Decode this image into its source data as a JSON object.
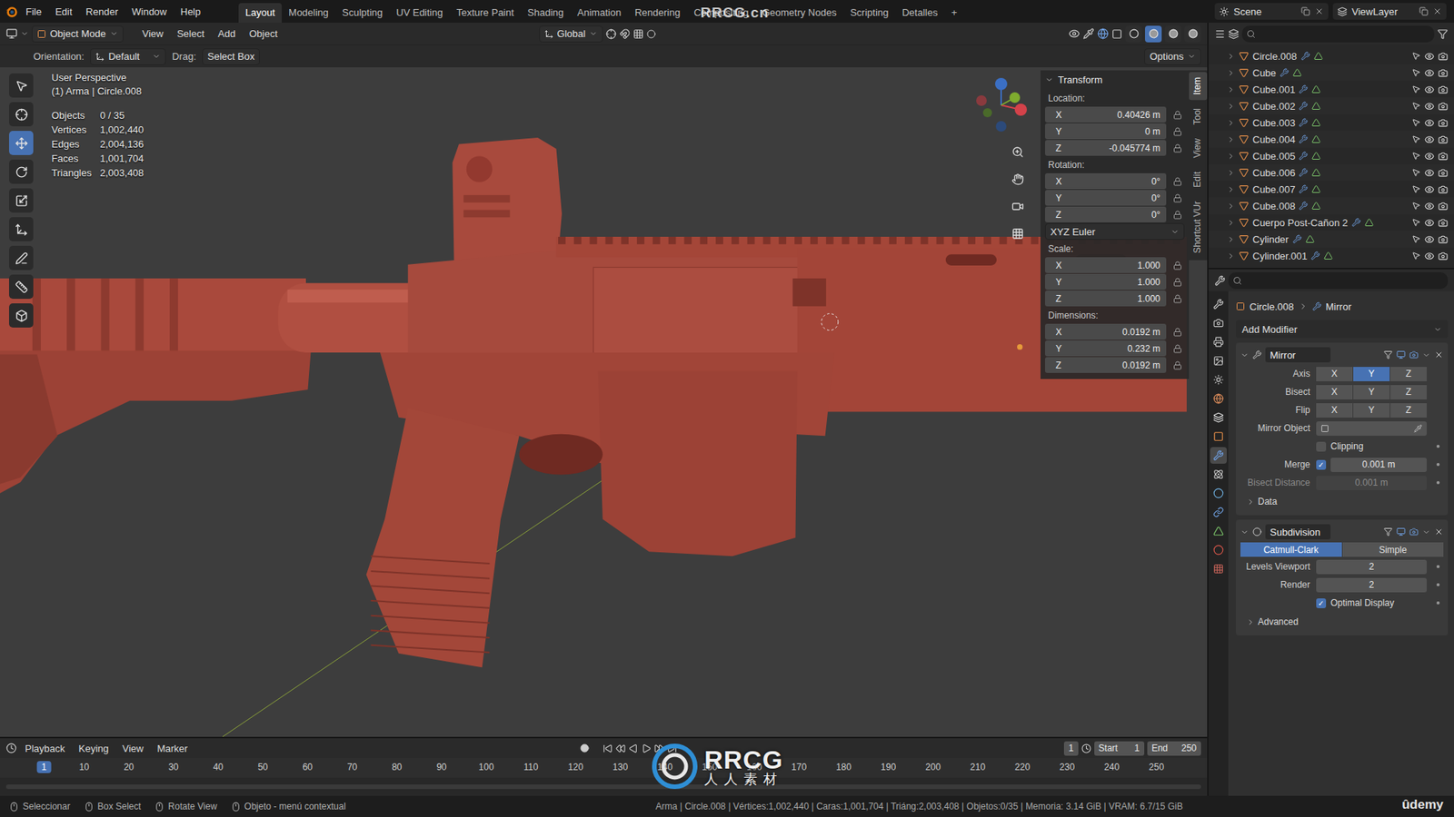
{
  "top_bar": {
    "menu": [
      "File",
      "Edit",
      "Render",
      "Window",
      "Help"
    ],
    "workspaces": [
      {
        "label": "Layout",
        "selected": true
      },
      {
        "label": "Modeling",
        "selected": false
      },
      {
        "label": "Sculpting",
        "selected": false
      },
      {
        "label": "UV Editing",
        "selected": false
      },
      {
        "label": "Texture Paint",
        "selected": false
      },
      {
        "label": "Shading",
        "selected": false
      },
      {
        "label": "Animation",
        "selected": false
      },
      {
        "label": "Rendering",
        "selected": false
      },
      {
        "label": "Compositing",
        "selected": false
      },
      {
        "label": "Geometry Nodes",
        "selected": false
      },
      {
        "label": "Scripting",
        "selected": false
      },
      {
        "label": "Detalles",
        "selected": false
      }
    ],
    "add_workspace": "+",
    "scene": "Scene",
    "view_layer": "ViewLayer"
  },
  "viewport_header": {
    "mode": "Object Mode",
    "menus": [
      "View",
      "Select",
      "Add",
      "Object"
    ],
    "orientation": "Global",
    "shading": [
      {
        "selected": false
      },
      {
        "selected": true
      },
      {
        "selected": false
      },
      {
        "selected": false
      }
    ]
  },
  "tool_settings": {
    "orientation_label": "Orientation:",
    "orientation": "Default",
    "drag_label": "Drag:",
    "drag": "Select Box",
    "options": "Options"
  },
  "toolbar": [
    {
      "selected": false
    },
    {
      "selected": false
    },
    {
      "selected": true
    },
    {
      "selected": false
    },
    {
      "selected": false
    },
    {
      "selected": false
    },
    {
      "selected": false
    },
    {
      "selected": false
    },
    {
      "selected": false
    }
  ],
  "viewport": {
    "title": "User Perspective",
    "context": "(1) Arma | Circle.008",
    "stats": [
      {
        "label": "Objects",
        "value": "0 / 35"
      },
      {
        "label": "Vertices",
        "value": "1,002,440"
      },
      {
        "label": "Edges",
        "value": "2,004,136"
      },
      {
        "label": "Faces",
        "value": "1,001,704"
      },
      {
        "label": "Triangles",
        "value": "2,003,408"
      }
    ]
  },
  "sidebar": {
    "title": "Transform",
    "location": {
      "label": "Location:",
      "fields": [
        {
          "axis": "X",
          "value": "0.40426 m"
        },
        {
          "axis": "Y",
          "value": "0 m"
        },
        {
          "axis": "Z",
          "value": "-0.045774 m"
        }
      ]
    },
    "rotation": {
      "label": "Rotation:",
      "fields": [
        {
          "axis": "X",
          "value": "0°"
        },
        {
          "axis": "Y",
          "value": "0°"
        },
        {
          "axis": "Z",
          "value": "0°"
        }
      ]
    },
    "rotation_mode": "XYZ Euler",
    "scale": {
      "label": "Scale:",
      "fields": [
        {
          "axis": "X",
          "value": "1.000"
        },
        {
          "axis": "Y",
          "value": "1.000"
        },
        {
          "axis": "Z",
          "value": "1.000"
        }
      ]
    },
    "dimensions": {
      "label": "Dimensions:",
      "fields": [
        {
          "axis": "X",
          "value": "0.0192 m"
        },
        {
          "axis": "Y",
          "value": "0.232 m"
        },
        {
          "axis": "Z",
          "value": "0.0192 m"
        }
      ]
    },
    "tabs": [
      {
        "label": "Item",
        "selected": true
      },
      {
        "label": "Tool",
        "selected": false
      },
      {
        "label": "View",
        "selected": false
      },
      {
        "label": "Edit",
        "selected": false
      },
      {
        "label": "Shortcut VUr",
        "selected": false
      }
    ]
  },
  "outliner": {
    "rows": [
      {
        "name": "Circle.008"
      },
      {
        "name": "Cube"
      },
      {
        "name": "Cube.001"
      },
      {
        "name": "Cube.002"
      },
      {
        "name": "Cube.003"
      },
      {
        "name": "Cube.004"
      },
      {
        "name": "Cube.005"
      },
      {
        "name": "Cube.006"
      },
      {
        "name": "Cube.007"
      },
      {
        "name": "Cube.008"
      },
      {
        "name": "Cuerpo Post-Cañon 2"
      },
      {
        "name": "Cylinder"
      },
      {
        "name": "Cylinder.001"
      }
    ]
  },
  "properties": {
    "tabs": [
      {
        "selected": false
      },
      {
        "selected": false
      },
      {
        "selected": false
      },
      {
        "selected": false
      },
      {
        "selected": false
      },
      {
        "selected": false
      },
      {
        "selected": false
      },
      {
        "selected": false
      },
      {
        "selected": true
      },
      {
        "selected": false
      },
      {
        "selected": false
      },
      {
        "selected": false
      },
      {
        "selected": false
      },
      {
        "selected": false
      },
      {
        "selected": false
      }
    ],
    "breadcrumb": [
      "Circle.008",
      "Mirror"
    ],
    "add_modifier": "Add Modifier",
    "mirror": {
      "name": "Mirror",
      "expanded": true,
      "axis_rows": [
        {
          "label": "Axis",
          "buttons": [
            {
              "label": "X",
              "selected": false
            },
            {
              "label": "Y",
              "selected": true
            },
            {
              "label": "Z",
              "selected": false
            }
          ]
        },
        {
          "label": "Bisect",
          "buttons": [
            {
              "label": "X",
              "selected": false
            },
            {
              "label": "Y",
              "selected": false
            },
            {
              "label": "Z",
              "selected": false
            }
          ]
        },
        {
          "label": "Flip",
          "buttons": [
            {
              "label": "X",
              "selected": false
            },
            {
              "label": "Y",
              "selected": false
            },
            {
              "label": "Z",
              "selected": false
            }
          ]
        }
      ],
      "mirror_object": {
        "label": "Mirror Object"
      },
      "clipping": {
        "label": "Clipping",
        "checked": false
      },
      "merge": {
        "label": "Merge",
        "checked": true,
        "value": "0.001 m"
      },
      "bisect_distance": {
        "label": "Bisect Distance",
        "value": "0.001 m",
        "disabled": true
      },
      "data": {
        "label": "Data",
        "expanded": false
      }
    },
    "subdivision": {
      "name": "Subdivision",
      "expanded": true,
      "methods": [
        {
          "label": "Catmull-Clark",
          "selected": true
        },
        {
          "label": "Simple",
          "selected": false
        }
      ],
      "levels_viewport": {
        "label": "Levels Viewport",
        "value": "2"
      },
      "render": {
        "label": "Render",
        "value": "2"
      },
      "optimal_display": {
        "label": "Optimal Display",
        "checked": true
      },
      "advanced": {
        "label": "Advanced",
        "expanded": false
      }
    }
  },
  "timeline": {
    "menus": [
      "Playback",
      "Keying",
      "View",
      "Marker"
    ],
    "current_frame": "1",
    "start_label": "Start",
    "start": "1",
    "end_label": "End",
    "end": "250",
    "ticks": [
      {
        "label": "1",
        "selected": true
      },
      {
        "label": "10",
        "selected": false
      },
      {
        "label": "20",
        "selected": false
      },
      {
        "label": "30",
        "selected": false
      },
      {
        "label": "40",
        "selected": false
      },
      {
        "label": "50",
        "selected": false
      },
      {
        "label": "60",
        "selected": false
      },
      {
        "label": "70",
        "selected": false
      },
      {
        "label": "80",
        "selected": false
      },
      {
        "label": "90",
        "selected": false
      },
      {
        "label": "100",
        "selected": false
      },
      {
        "label": "110",
        "selected": false
      },
      {
        "label": "120",
        "selected": false
      },
      {
        "label": "130",
        "selected": false
      },
      {
        "label": "140",
        "selected": false
      },
      {
        "label": "150",
        "selected": false
      },
      {
        "label": "160",
        "selected": false
      },
      {
        "label": "170",
        "selected": false
      },
      {
        "label": "180",
        "selected": false
      },
      {
        "label": "190",
        "selected": false
      },
      {
        "label": "200",
        "selected": false
      },
      {
        "label": "210",
        "selected": false
      },
      {
        "label": "220",
        "selected": false
      },
      {
        "label": "230",
        "selected": false
      },
      {
        "label": "240",
        "selected": false
      },
      {
        "label": "250",
        "selected": false
      }
    ]
  },
  "status_bar": {
    "hints": [
      "Seleccionar",
      "Box Select",
      "Rotate View",
      "Objeto - menú contextual"
    ],
    "info": "Arma | Circle.008 | Vértices:1,002,440 | Caras:1,001,704 | Triáng:2,003,408 | Objetos:0/35 | Memoria: 3.14 GiB | VRAM: 6.7/15 GiB"
  },
  "watermarks": {
    "top": "RRCG.cn",
    "logo": "RRCG",
    "logo_sub": "人人素材",
    "udemy": "ûdemy"
  }
}
